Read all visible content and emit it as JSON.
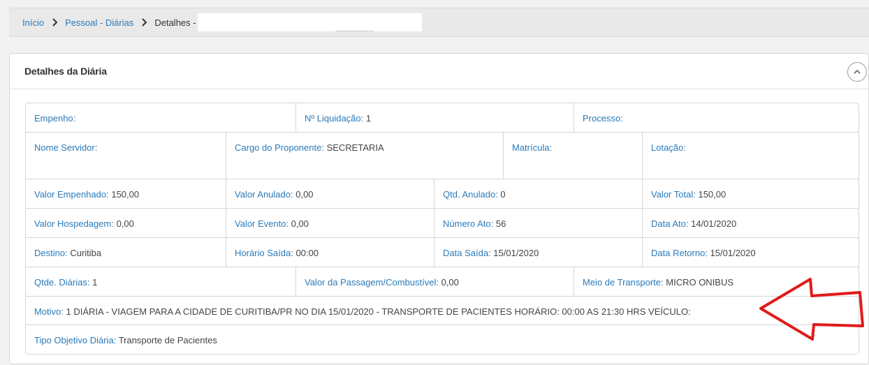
{
  "breadcrumb": {
    "home": "Início",
    "section": "Pessoal - Diárias",
    "current": "Detalhes -"
  },
  "panel": {
    "title": "Detalhes da Diária"
  },
  "details": {
    "empenho": {
      "label": "Empenho:",
      "value": ""
    },
    "liquidacao": {
      "label": "Nº Liquidação:",
      "value": "1"
    },
    "processo": {
      "label": "Processo:",
      "value": ""
    },
    "nome_servidor": {
      "label": "Nome Servidor:",
      "value": ""
    },
    "cargo": {
      "label": "Cargo do Proponente:",
      "value": "SECRETARIA"
    },
    "matricula": {
      "label": "Matrícula:",
      "value": ""
    },
    "lotacao": {
      "label": "Lotação:",
      "value": ""
    },
    "valor_empenhado": {
      "label": "Valor Empenhado:",
      "value": "150,00"
    },
    "valor_anulado": {
      "label": "Valor Anulado:",
      "value": "0,00"
    },
    "qtd_anulado": {
      "label": "Qtd. Anulado:",
      "value": "0"
    },
    "valor_total": {
      "label": "Valor Total:",
      "value": "150,00"
    },
    "valor_hospedagem": {
      "label": "Valor Hospedagem:",
      "value": "0,00"
    },
    "valor_evento": {
      "label": "Valor Evento:",
      "value": "0,00"
    },
    "numero_ato": {
      "label": "Número Ato:",
      "value": "56"
    },
    "data_ato": {
      "label": "Data Ato:",
      "value": "14/01/2020"
    },
    "destino": {
      "label": "Destino:",
      "value": "Curitiba"
    },
    "horario_saida": {
      "label": "Horário Saída:",
      "value": "00:00"
    },
    "data_saida": {
      "label": "Data Saída:",
      "value": "15/01/2020"
    },
    "data_retorno": {
      "label": "Data Retorno:",
      "value": "15/01/2020"
    },
    "qtde_diarias": {
      "label": "Qtde. Diárias:",
      "value": "1"
    },
    "valor_passagem": {
      "label": "Valor da Passagem/Combustível:",
      "value": "0,00"
    },
    "meio_transporte": {
      "label": "Meio de Transporte:",
      "value": "MICRO ONIBUS"
    },
    "motivo": {
      "label": "Motivo:",
      "value": "1 DIÁRIA - VIAGEM PARA A CIDADE DE CURITIBA/PR NO DIA 15/01/2020 - TRANSPORTE DE PACIENTES HORÁRIO: 00:00 AS 21:30 HRS VEÍCULO:"
    },
    "tipo_objetivo": {
      "label": "Tipo Objetivo Diária:",
      "value": "Transporte de Pacientes"
    }
  },
  "colors": {
    "label_blue": "#2a7ab9",
    "annotation_arrow": "#e01b1b"
  }
}
